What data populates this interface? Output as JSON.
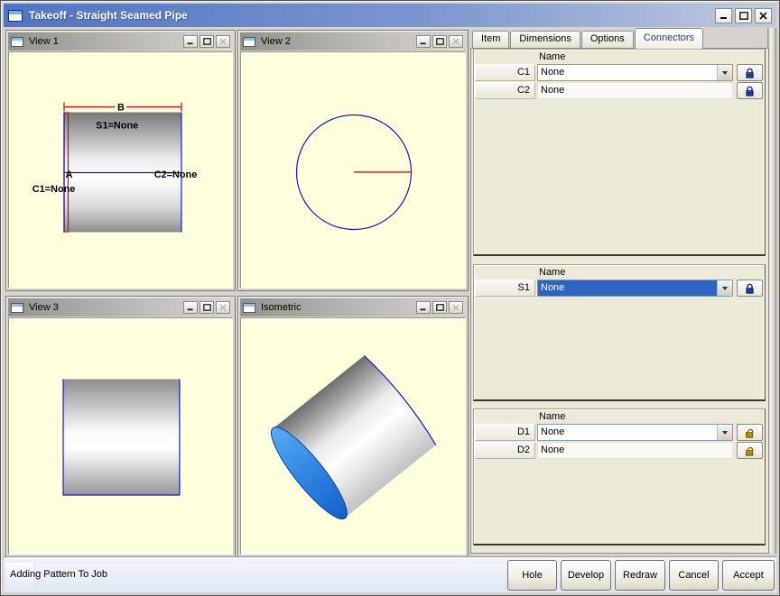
{
  "window": {
    "title": "Takeoff - Straight Seamed Pipe"
  },
  "views": [
    {
      "title": "View 1",
      "labels": {
        "b": "B",
        "s1": "S1=None",
        "a": "A",
        "c2": "C2=None",
        "c1": "C1=None"
      }
    },
    {
      "title": "View 2"
    },
    {
      "title": "View 3"
    },
    {
      "title": "Isometric"
    }
  ],
  "tabs": [
    {
      "label": "Item"
    },
    {
      "label": "Dimensions"
    },
    {
      "label": "Options"
    },
    {
      "label": "Connectors",
      "active": true
    }
  ],
  "connectors": {
    "groups": [
      {
        "header": "Name",
        "rows": [
          {
            "label": "C1",
            "value": "None",
            "control": "dropdown",
            "lock": "locked"
          },
          {
            "label": "C2",
            "value": "None",
            "control": "static",
            "lock": "locked"
          }
        ]
      },
      {
        "header": "Name",
        "rows": [
          {
            "label": "S1",
            "value": "None",
            "control": "dropdown-selected",
            "lock": "locked"
          }
        ]
      },
      {
        "header": "Name",
        "rows": [
          {
            "label": "D1",
            "value": "None",
            "control": "dropdown",
            "lock": "unlocked"
          },
          {
            "label": "D2",
            "value": "None",
            "control": "static",
            "lock": "unlocked"
          }
        ]
      }
    ]
  },
  "statusbar": {
    "text": "Adding Pattern To Job"
  },
  "actions": {
    "hole": "Hole",
    "develop": "Develop",
    "redraw": "Redraw",
    "cancel": "Cancel",
    "accept": "Accept"
  },
  "colors": {
    "titlebar-start": "#4f74c4",
    "titlebar-mid": "#7b97cf",
    "titlebar-end": "#bfcadf",
    "childbar-start": "#94938c",
    "childbar-end": "#dad7d2",
    "view-bg": "#ffffde",
    "panel-bg": "#ece9d8",
    "selection": "#2e63c4",
    "drawing-blue": "#1414cc",
    "drawing-red": "#dd1111",
    "cap-blue": "#1b7fe8",
    "lock-blue": "#2456c8",
    "lock-gold": "#d0a800",
    "status-bg": "#dfe5f3"
  }
}
